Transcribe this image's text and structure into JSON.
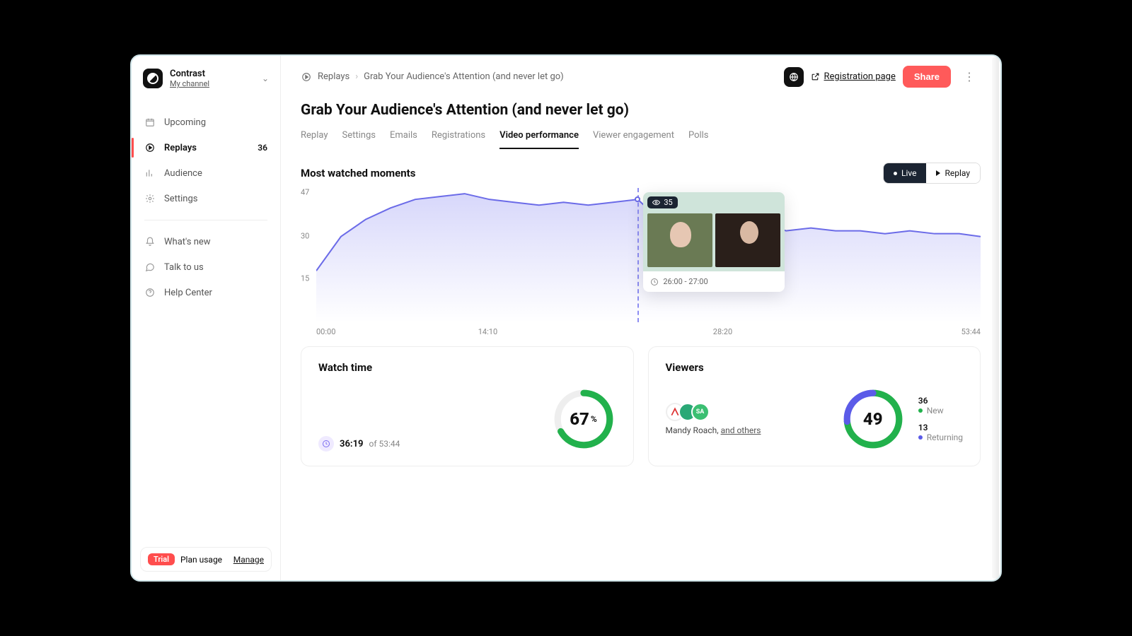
{
  "brand": {
    "name": "Contrast",
    "subtitle": "My channel"
  },
  "sidebar": {
    "items": [
      {
        "label": "Upcoming"
      },
      {
        "label": "Replays",
        "count": "36"
      },
      {
        "label": "Audience"
      },
      {
        "label": "Settings"
      }
    ],
    "secondary": [
      {
        "label": "What's new"
      },
      {
        "label": "Talk to us"
      },
      {
        "label": "Help Center"
      }
    ],
    "plan": {
      "badge": "Trial",
      "label": "Plan usage",
      "manage": "Manage"
    }
  },
  "breadcrumb": {
    "root": "Replays",
    "current": "Grab Your Audience's Attention (and never let go)"
  },
  "header": {
    "registration": "Registration page",
    "share": "Share"
  },
  "page": {
    "title": "Grab Your Audience's Attention (and never let go)"
  },
  "tabs": [
    "Replay",
    "Settings",
    "Emails",
    "Registrations",
    "Video performance",
    "Viewer engagement",
    "Polls"
  ],
  "active_tab": "Video performance",
  "section": {
    "title": "Most watched moments",
    "toggle": {
      "live": "Live",
      "replay": "Replay",
      "active": "live"
    }
  },
  "chart_data": {
    "type": "area",
    "title": "Most watched moments",
    "xlabel": "",
    "ylabel": "",
    "ylim": [
      0,
      47
    ],
    "y_ticks": [
      15,
      30,
      47
    ],
    "x_ticks": [
      "00:00",
      "14:10",
      "28:20",
      "53:44"
    ],
    "x": [
      0,
      2,
      4,
      6,
      8,
      10,
      12,
      14,
      16,
      18,
      20,
      22,
      24,
      26,
      28,
      30,
      32,
      34,
      36,
      38,
      40,
      42,
      44,
      46,
      48,
      50,
      52,
      53.73
    ],
    "values": [
      18,
      30,
      36,
      40,
      43,
      44,
      45,
      43,
      42,
      41,
      42,
      41,
      42,
      43,
      35,
      36,
      36,
      35,
      35,
      32,
      33,
      32,
      32,
      31,
      32,
      31,
      31,
      30
    ],
    "hover": {
      "viewers": "35",
      "range": "26:00 - 27:00",
      "x": 26,
      "y": 43
    }
  },
  "cards": {
    "watch": {
      "title": "Watch time",
      "percent": 67,
      "time": "36:19",
      "of_label": "of 53:44"
    },
    "viewers": {
      "title": "Viewers",
      "total": 49,
      "name": "Mandy Roach,",
      "others": "and others",
      "new": {
        "count": "36",
        "label": "New"
      },
      "returning": {
        "count": "13",
        "label": "Returning"
      }
    }
  }
}
